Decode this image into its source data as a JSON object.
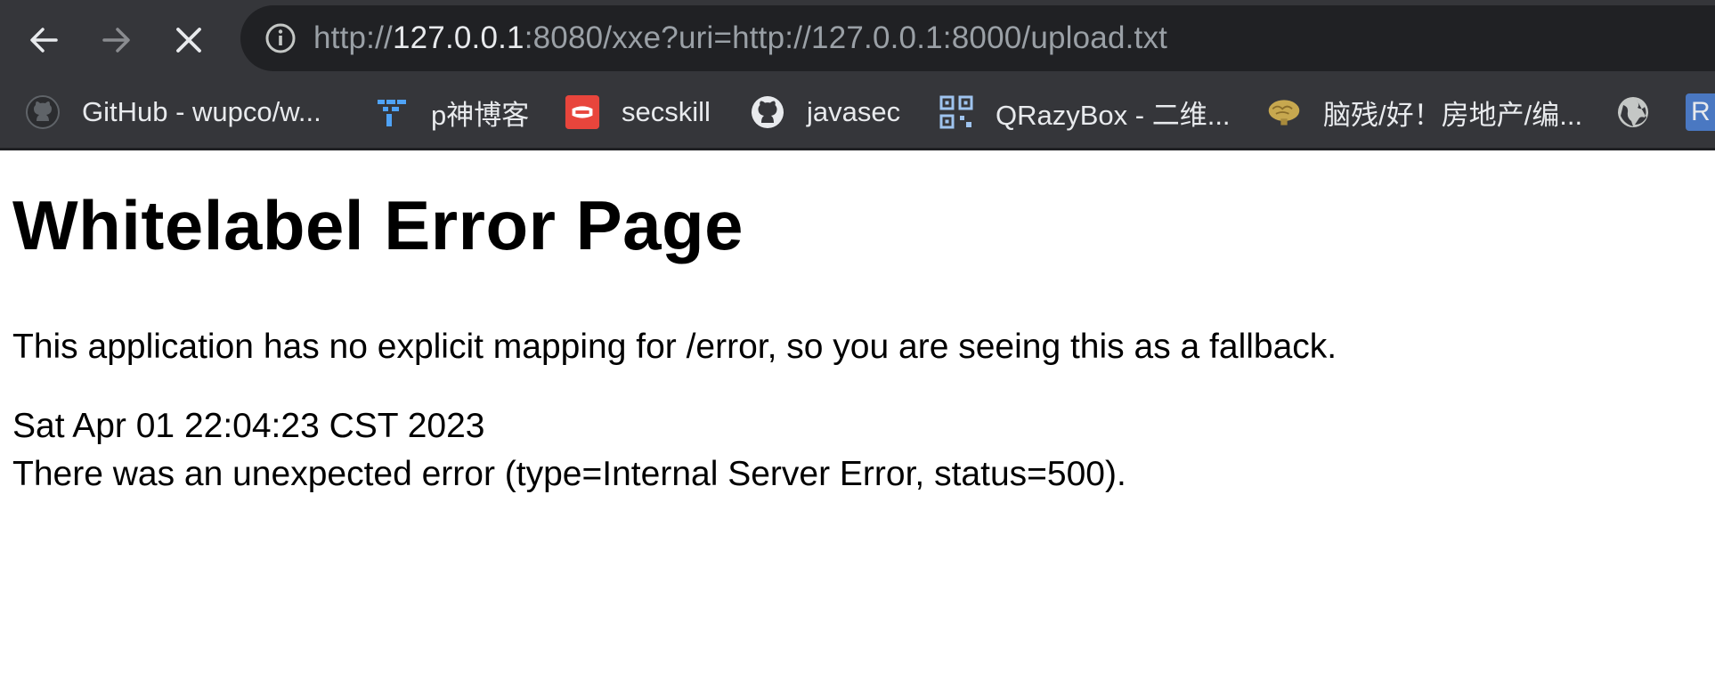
{
  "browser": {
    "url": {
      "scheme": "http://",
      "host": "127.0.0.1",
      "rest": ":8080/xxe?uri=http://127.0.0.1:8000/upload.txt"
    },
    "nav_icons": [
      "back-arrow-icon",
      "forward-arrow-icon",
      "stop-loading-icon"
    ],
    "site_info_icon": "info-icon",
    "bookmarks": [
      {
        "label": "GitHub - wupco/w...",
        "icon": "github-icon"
      },
      {
        "label": "p神博客",
        "icon": "p-blog-icon"
      },
      {
        "label": "secskill",
        "icon": "secskill-icon"
      },
      {
        "label": "javasec",
        "icon": "github-icon"
      },
      {
        "label": "QRazyBox - 二维...",
        "icon": "qr-code-icon"
      },
      {
        "label": "脑残/好！房地产/编...",
        "icon": "brain-icon"
      },
      {
        "label": "",
        "icon": "globe-icon"
      },
      {
        "label": "R",
        "icon": "r-badge-icon"
      }
    ]
  },
  "page": {
    "title": "Whitelabel Error Page",
    "message": "This application has no explicit mapping for /error, so you are seeing this as a fallback.",
    "timestamp": "Sat Apr 01 22:04:23 CST 2023",
    "error": "There was an unexpected error (type=Internal Server Error, status=500)."
  },
  "colors": {
    "chrome_bg": "#35363a",
    "omnibox_bg": "#202124",
    "host_text": "#e8eaed",
    "url_muted": "#9aa0a6"
  }
}
